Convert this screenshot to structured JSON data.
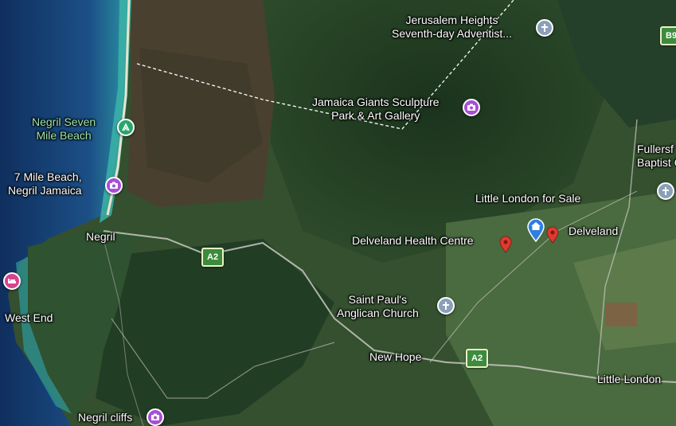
{
  "map": {
    "colors": {
      "ocean_deep": "#143a6e",
      "reef": "#2aa6a6",
      "land_dark": "#1f3a22",
      "land_mid": "#3a5a33",
      "attraction": "#a64fd6",
      "church": "#8aa0b8",
      "park": "#27a56a",
      "hotel": "#d6438e",
      "route_green": "#3d8b3d",
      "pin_red": "#e03a2f",
      "pin_blue": "#2f7fe0"
    },
    "places": {
      "jerusalem": {
        "line1": "Jerusalem Heights",
        "line2": "Seventh-day Adventist..."
      },
      "giants": {
        "line1": "Jamaica Giants Sculpture",
        "line2": "Park & Art Gallery"
      },
      "negril_seven": {
        "line1": "Negril Seven",
        "line2": "Mile Beach"
      },
      "seven_mile": {
        "line1": "7 Mile Beach,",
        "line2": "Negril Jamaica"
      },
      "fullersfield": {
        "line1": "Fullersf",
        "line2": "Baptist C"
      },
      "little_london_sale": "Little London for Sale",
      "delveland": "Delveland",
      "delveland_health": "Delveland Health Centre",
      "negril": "Negril",
      "west_end": "West End",
      "saint_pauls": {
        "line1": "Saint Paul's",
        "line2": "Anglican Church"
      },
      "new_hope": "New Hope",
      "little_london": "Little London",
      "negril_cliffs": "Negril cliffs"
    },
    "routes": {
      "a2": "A2",
      "b9": "B9"
    },
    "icons": {
      "church": "cross-icon",
      "attraction": "camera-icon",
      "park": "hiking-icon",
      "hotel": "bed-icon",
      "home": "home-icon",
      "health": "pin-icon"
    }
  }
}
